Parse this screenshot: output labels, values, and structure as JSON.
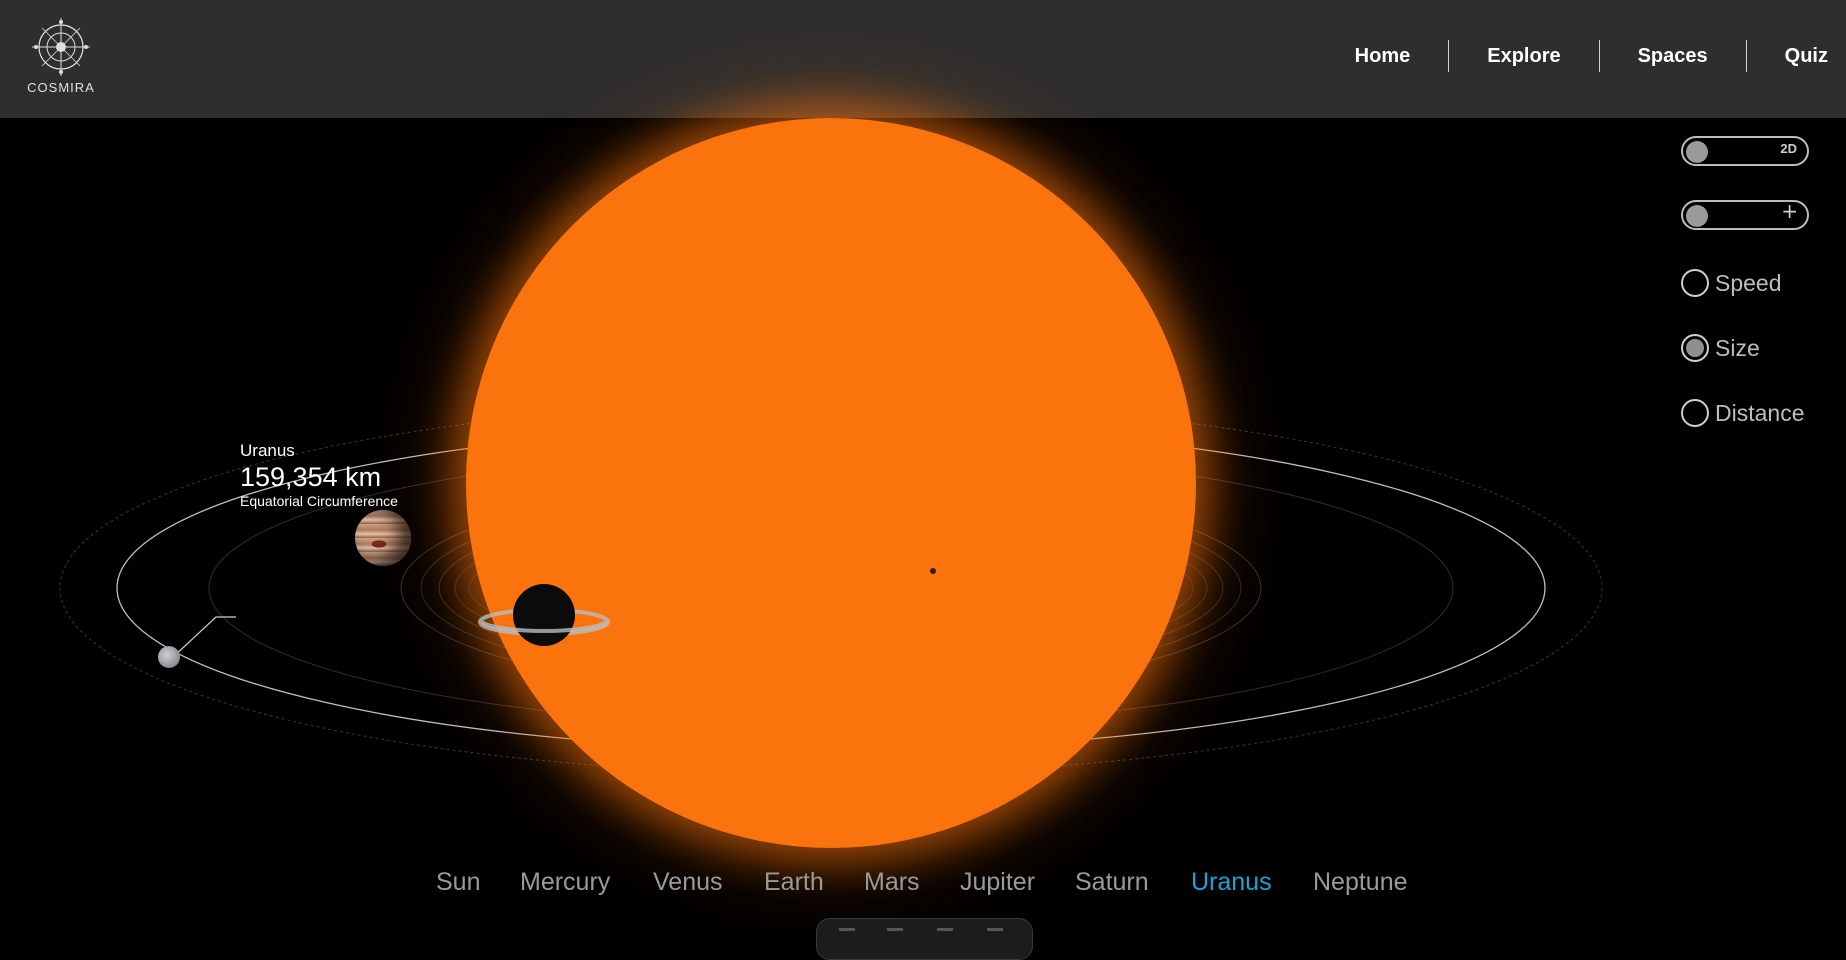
{
  "header": {
    "logo_text": "COSMIRA",
    "nav": [
      "Home",
      "Explore",
      "Spaces",
      "Quiz"
    ]
  },
  "controls": {
    "view_toggle_label": "2D",
    "add_toggle_symbol": "+",
    "scale_options": [
      {
        "label": "Speed",
        "checked": false
      },
      {
        "label": "Size",
        "checked": true
      },
      {
        "label": "Distance",
        "checked": false
      }
    ]
  },
  "info": {
    "planet": "Uranus",
    "value": "159,354 km",
    "label": "Equatorial Circumference"
  },
  "planet_menu": {
    "items": [
      "Sun",
      "Mercury",
      "Venus",
      "Earth",
      "Mars",
      "Jupiter",
      "Saturn",
      "Uranus",
      "Neptune"
    ],
    "active": "Uranus"
  },
  "colors": {
    "header_bg": "#2e2e2e",
    "sun": "#fb730c",
    "active_planet": "#1aa3d6",
    "menu_text": "#9a9a9a"
  }
}
